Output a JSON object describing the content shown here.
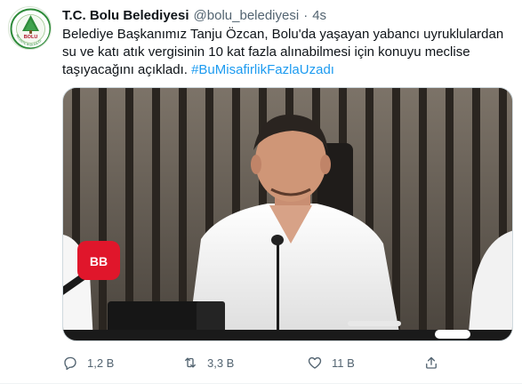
{
  "tweet": {
    "author": {
      "display_name": "T.C. Bolu Belediyesi",
      "handle": "@bolu_belediyesi",
      "separator": "·",
      "time": "4s",
      "avatar_logo_text": "BOLU",
      "avatar_ring_text": "BELEDİYE BAŞKANLIĞI"
    },
    "text": {
      "line1": "Belediye Başkanımız Tanju Özcan, Bolu'da yaşayan yabancı uyruklulardan",
      "line2": "su ve katı atık vergisinin 10 kat fazla alınabilmesi için konuyu meclise",
      "line3_prefix": "taşıyacağını açıkladı. ",
      "hashtag": "#BuMisafirlikFazlaUzadı"
    },
    "media": {
      "type": "photo",
      "mic_flag_text": "BB"
    },
    "actions": {
      "reply_count": "1,2 B",
      "retweet_count": "3,3 B",
      "like_count": "11 B"
    }
  },
  "icons": {
    "reply": "reply-icon",
    "retweet": "retweet-icon",
    "like": "heart-icon",
    "share": "share-icon"
  },
  "colors": {
    "accent": "#1d9bf0",
    "secondary_text": "#536471",
    "logo_green": "#2e8b3a",
    "mic_red": "#e0162b"
  }
}
